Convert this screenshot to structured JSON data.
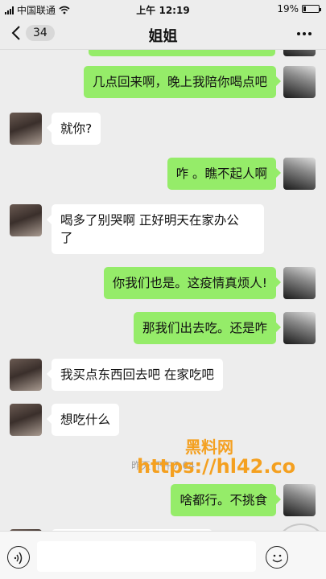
{
  "status_bar": {
    "carrier": "中国联通",
    "time": "上午 12:19",
    "battery": "19%",
    "battery_level": 0.19
  },
  "nav": {
    "back_count": "34",
    "title": "姐姐",
    "more_icon": "more-dots-icon"
  },
  "messages": [
    {
      "side": "right",
      "text": "几点回来啊，晚上我陪你喝点吧"
    },
    {
      "side": "left",
      "text": "就你?"
    },
    {
      "side": "right",
      "text": "咋 。瞧不起人啊"
    },
    {
      "side": "left",
      "line1": "喝多了别哭啊 正好明天在家办公",
      "line2": "了"
    },
    {
      "side": "right",
      "text": "你我们也是。这疫情真烦人!"
    },
    {
      "side": "right",
      "text": "那我们出去吃。还是咋"
    },
    {
      "side": "left",
      "text": "我买点东西回去吧 在家吃吧"
    },
    {
      "side": "left",
      "text": "想吃什么"
    },
    {
      "side": "right",
      "text": "啥都行。不挑食"
    }
  ],
  "timestamp": "昨天 下午7:04",
  "watermark": {
    "line1": "黑料网",
    "line2": "https://hl42.co"
  },
  "input_bar": {
    "voice_icon": "voice-icon",
    "emoji_icon": "emoji-icon",
    "input_value": ""
  },
  "colors": {
    "background": "#ededed",
    "bubble_self": "#95ec69",
    "bubble_other": "#ffffff",
    "watermark": "#f4a020"
  }
}
